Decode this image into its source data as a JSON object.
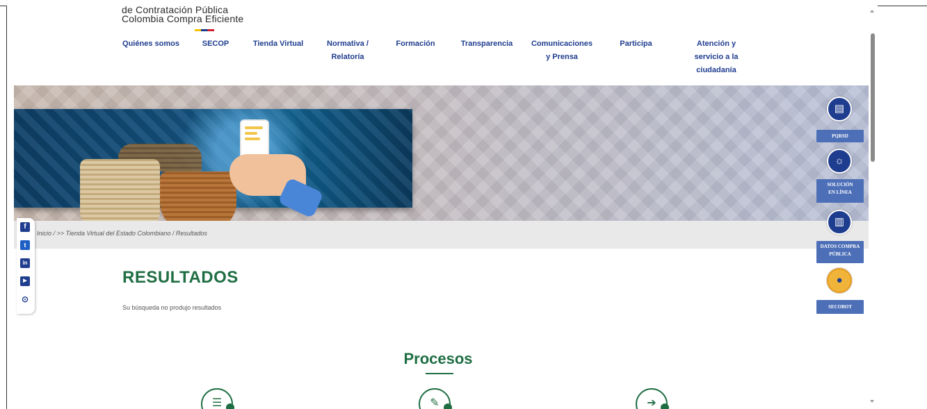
{
  "logo": {
    "line1": "de Contratación Pública",
    "line2": "Colombia Compra Eficiente"
  },
  "nav": [
    {
      "label": "Quiénes somos"
    },
    {
      "label": "SECOP"
    },
    {
      "label": "Tienda Virtual"
    },
    {
      "label": "Normativa /\nRelatoría"
    },
    {
      "label": "Formación"
    },
    {
      "label": "Transparencia"
    },
    {
      "label": "Comunicaciones\ny Prensa"
    },
    {
      "label": "Participa"
    },
    {
      "label": "Atención y\nservicio a la\nciudadanía"
    }
  ],
  "breadcrumb": "Inicio / >> Tienda Virtual del Estado Colombiano / Resultados",
  "main": {
    "title": "RESULTADOS",
    "no_results": "Su búsqueda no produjo resultados",
    "section": "Procesos"
  },
  "right_bar": [
    {
      "icon": "document-icon",
      "label": "PQRSD"
    },
    {
      "icon": "lightbulb-icon",
      "label": "SOLUCIÓN\nEN LÍNEA"
    },
    {
      "icon": "chart-icon",
      "label": "DATOS COMPRA\nPÚBLICA"
    },
    {
      "icon": "secobot-icon",
      "label": "SECOBOT"
    }
  ],
  "social": [
    {
      "icon": "facebook-icon",
      "glyph": "f"
    },
    {
      "icon": "twitter-icon",
      "glyph": "t"
    },
    {
      "icon": "linkedin-icon",
      "glyph": "in"
    },
    {
      "icon": "youtube-icon",
      "glyph": "▶"
    },
    {
      "icon": "rss-icon",
      "glyph": "⊙"
    }
  ],
  "colors": {
    "nav_text": "#1f3d8f",
    "heading_green": "#1f6e43",
    "side_label": "#4d6fb8"
  }
}
